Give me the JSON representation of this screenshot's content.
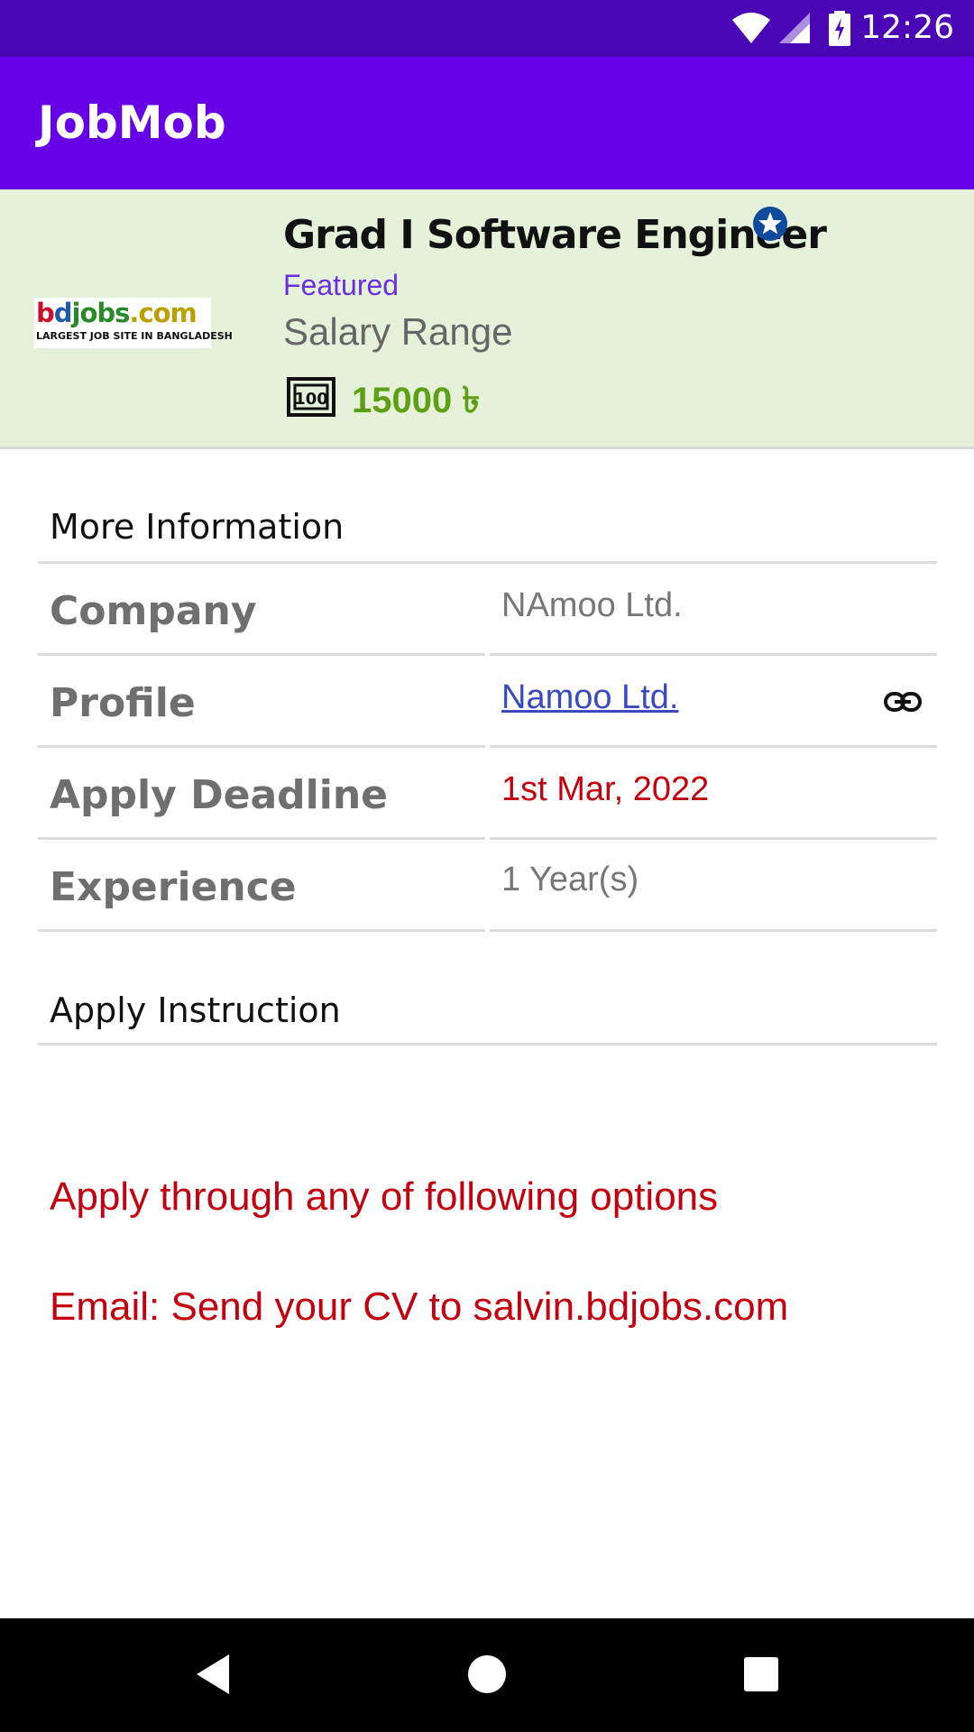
{
  "status_bar": {
    "time": "12:26",
    "icons": [
      "wifi-icon",
      "signal-icon",
      "battery-charging-icon"
    ]
  },
  "app_bar": {
    "title": "JobMob"
  },
  "job": {
    "title": "Grad I Software Engineer",
    "featured_label": "Featured",
    "salary_label": "Salary Range",
    "salary_value": "15000 ৳",
    "logo": {
      "brand_parts": [
        "b",
        "d",
        "jobs",
        ".com"
      ],
      "tagline": "LARGEST JOB SITE IN BANGLADESH"
    }
  },
  "more_info": {
    "section_title": "More Information",
    "rows": [
      {
        "label": "Company",
        "value": "NAmoo Ltd."
      },
      {
        "label": "Profile",
        "value": "Namoo Ltd."
      },
      {
        "label": "Apply Deadline",
        "value": "1st Mar, 2022"
      },
      {
        "label": "Experience",
        "value": "1 Year(s)"
      }
    ]
  },
  "apply": {
    "section_title": "Apply Instruction",
    "lines": [
      "Apply through any of following options",
      "Email: Send your CV to salvin.bdjobs.com"
    ]
  },
  "colors": {
    "status_bar": "#4a06b5",
    "app_bar": "#6503e6",
    "header_bg": "#e6f1da",
    "salary_green": "#5da016",
    "deadline_red": "#c30010",
    "link_blue": "#3b4bbf"
  }
}
